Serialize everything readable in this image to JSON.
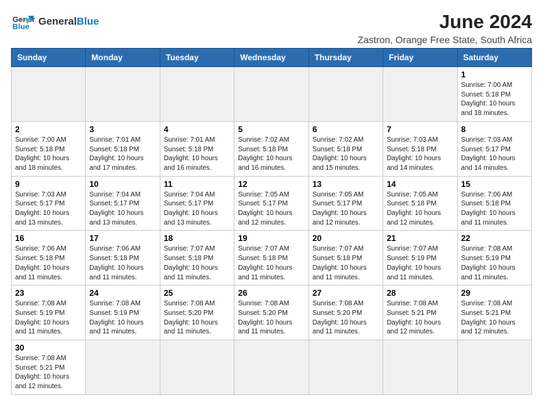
{
  "logo": {
    "text_general": "General",
    "text_blue": "Blue"
  },
  "title": "June 2024",
  "subtitle": "Zastron, Orange Free State, South Africa",
  "weekdays": [
    "Sunday",
    "Monday",
    "Tuesday",
    "Wednesday",
    "Thursday",
    "Friday",
    "Saturday"
  ],
  "weeks": [
    [
      {
        "day": "",
        "info": "",
        "empty": true
      },
      {
        "day": "",
        "info": "",
        "empty": true
      },
      {
        "day": "",
        "info": "",
        "empty": true
      },
      {
        "day": "",
        "info": "",
        "empty": true
      },
      {
        "day": "",
        "info": "",
        "empty": true
      },
      {
        "day": "",
        "info": "",
        "empty": true
      },
      {
        "day": "1",
        "info": "Sunrise: 7:00 AM\nSunset: 5:18 PM\nDaylight: 10 hours and 18 minutes."
      }
    ],
    [
      {
        "day": "2",
        "info": "Sunrise: 7:00 AM\nSunset: 5:18 PM\nDaylight: 10 hours and 18 minutes."
      },
      {
        "day": "3",
        "info": "Sunrise: 7:01 AM\nSunset: 5:18 PM\nDaylight: 10 hours and 17 minutes."
      },
      {
        "day": "4",
        "info": "Sunrise: 7:01 AM\nSunset: 5:18 PM\nDaylight: 10 hours and 16 minutes."
      },
      {
        "day": "5",
        "info": "Sunrise: 7:02 AM\nSunset: 5:18 PM\nDaylight: 10 hours and 16 minutes."
      },
      {
        "day": "6",
        "info": "Sunrise: 7:02 AM\nSunset: 5:18 PM\nDaylight: 10 hours and 15 minutes."
      },
      {
        "day": "7",
        "info": "Sunrise: 7:03 AM\nSunset: 5:18 PM\nDaylight: 10 hours and 14 minutes."
      },
      {
        "day": "8",
        "info": "Sunrise: 7:03 AM\nSunset: 5:17 PM\nDaylight: 10 hours and 14 minutes."
      }
    ],
    [
      {
        "day": "9",
        "info": "Sunrise: 7:03 AM\nSunset: 5:17 PM\nDaylight: 10 hours and 13 minutes."
      },
      {
        "day": "10",
        "info": "Sunrise: 7:04 AM\nSunset: 5:17 PM\nDaylight: 10 hours and 13 minutes."
      },
      {
        "day": "11",
        "info": "Sunrise: 7:04 AM\nSunset: 5:17 PM\nDaylight: 10 hours and 13 minutes."
      },
      {
        "day": "12",
        "info": "Sunrise: 7:05 AM\nSunset: 5:17 PM\nDaylight: 10 hours and 12 minutes."
      },
      {
        "day": "13",
        "info": "Sunrise: 7:05 AM\nSunset: 5:17 PM\nDaylight: 10 hours and 12 minutes."
      },
      {
        "day": "14",
        "info": "Sunrise: 7:05 AM\nSunset: 5:18 PM\nDaylight: 10 hours and 12 minutes."
      },
      {
        "day": "15",
        "info": "Sunrise: 7:06 AM\nSunset: 5:18 PM\nDaylight: 10 hours and 11 minutes."
      }
    ],
    [
      {
        "day": "16",
        "info": "Sunrise: 7:06 AM\nSunset: 5:18 PM\nDaylight: 10 hours and 11 minutes."
      },
      {
        "day": "17",
        "info": "Sunrise: 7:06 AM\nSunset: 5:18 PM\nDaylight: 10 hours and 11 minutes."
      },
      {
        "day": "18",
        "info": "Sunrise: 7:07 AM\nSunset: 5:18 PM\nDaylight: 10 hours and 11 minutes."
      },
      {
        "day": "19",
        "info": "Sunrise: 7:07 AM\nSunset: 5:18 PM\nDaylight: 10 hours and 11 minutes."
      },
      {
        "day": "20",
        "info": "Sunrise: 7:07 AM\nSunset: 5:18 PM\nDaylight: 10 hours and 11 minutes."
      },
      {
        "day": "21",
        "info": "Sunrise: 7:07 AM\nSunset: 5:19 PM\nDaylight: 10 hours and 11 minutes."
      },
      {
        "day": "22",
        "info": "Sunrise: 7:08 AM\nSunset: 5:19 PM\nDaylight: 10 hours and 11 minutes."
      }
    ],
    [
      {
        "day": "23",
        "info": "Sunrise: 7:08 AM\nSunset: 5:19 PM\nDaylight: 10 hours and 11 minutes."
      },
      {
        "day": "24",
        "info": "Sunrise: 7:08 AM\nSunset: 5:19 PM\nDaylight: 10 hours and 11 minutes."
      },
      {
        "day": "25",
        "info": "Sunrise: 7:08 AM\nSunset: 5:20 PM\nDaylight: 10 hours and 11 minutes."
      },
      {
        "day": "26",
        "info": "Sunrise: 7:08 AM\nSunset: 5:20 PM\nDaylight: 10 hours and 11 minutes."
      },
      {
        "day": "27",
        "info": "Sunrise: 7:08 AM\nSunset: 5:20 PM\nDaylight: 10 hours and 11 minutes."
      },
      {
        "day": "28",
        "info": "Sunrise: 7:08 AM\nSunset: 5:21 PM\nDaylight: 10 hours and 12 minutes."
      },
      {
        "day": "29",
        "info": "Sunrise: 7:08 AM\nSunset: 5:21 PM\nDaylight: 10 hours and 12 minutes."
      }
    ],
    [
      {
        "day": "30",
        "info": "Sunrise: 7:08 AM\nSunset: 5:21 PM\nDaylight: 10 hours and 12 minutes."
      },
      {
        "day": "",
        "info": "",
        "empty": true
      },
      {
        "day": "",
        "info": "",
        "empty": true
      },
      {
        "day": "",
        "info": "",
        "empty": true
      },
      {
        "day": "",
        "info": "",
        "empty": true
      },
      {
        "day": "",
        "info": "",
        "empty": true
      },
      {
        "day": "",
        "info": "",
        "empty": true
      }
    ]
  ]
}
